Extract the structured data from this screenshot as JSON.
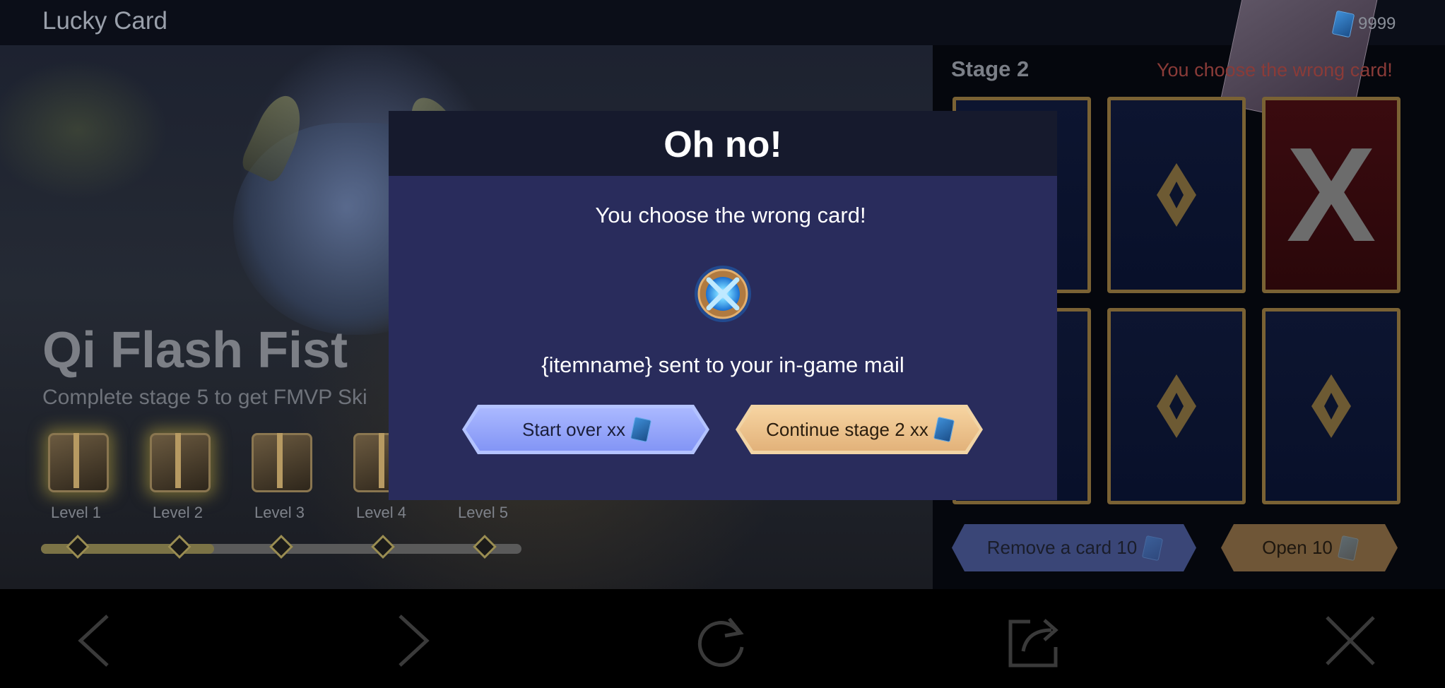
{
  "header": {
    "title": "Lucky Card",
    "currencies": [
      {
        "icon": "card-ticket-icon",
        "amount": "9999"
      },
      {
        "icon": "blue-gem-icon",
        "amount": "9999"
      }
    ]
  },
  "event": {
    "skin_name": "Qi Flash Fist",
    "subtitle": "Complete stage 5 to get FMVP Ski",
    "levels": [
      {
        "label": "Level 1",
        "reached": true
      },
      {
        "label": "Level 2",
        "reached": true
      },
      {
        "label": "Level 3",
        "reached": false
      },
      {
        "label": "Level 4",
        "reached": false
      },
      {
        "label": "Level 5",
        "reached": false
      }
    ],
    "progress_fraction": 0.36
  },
  "panel": {
    "stage_label": "Stage 2",
    "status_message": "You choose the wrong card!",
    "cards": [
      {
        "state": "hidden"
      },
      {
        "state": "hidden"
      },
      {
        "state": "revealed-wrong",
        "mark": "X"
      },
      {
        "state": "hidden"
      },
      {
        "state": "hidden"
      },
      {
        "state": "hidden"
      }
    ],
    "remove_button": "Remove a card 10",
    "open_button": "Open 10"
  },
  "bottom_nav": {
    "icons": [
      "chevron-left-icon",
      "chevron-right-icon",
      "refresh-icon",
      "share-icon",
      "close-icon"
    ]
  },
  "modal": {
    "title": "Oh no!",
    "message": "You choose the wrong card!",
    "reward_icon": "reward-emblem-icon",
    "mail_text": "{itemname} sent to your in-game mail",
    "start_over": "Start over xx",
    "continue": "Continue stage 2 xx"
  },
  "colors": {
    "modal_bg": "#292c5c",
    "modal_header": "#161a2d",
    "start_button": "#8395f5",
    "continue_button": "#e2b27a",
    "error_text": "#8a3b38"
  }
}
